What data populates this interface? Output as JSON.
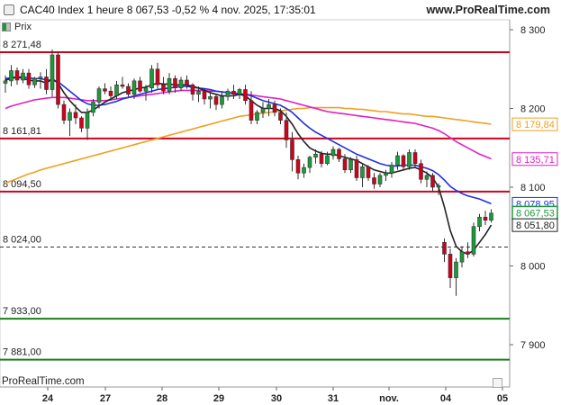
{
  "header": {
    "title": "CAC40 Index 1 heure 8 067,53 -0,52 % 4 nov. 2025, 17:35:01",
    "brand": "www.ProRealTime.com"
  },
  "legend": {
    "label": "Prix"
  },
  "footer": {
    "source": "ProRealTime.com"
  },
  "chart_data": {
    "type": "line",
    "subtype": "candlestick",
    "categories": [
      "24",
      "27",
      "28",
      "29",
      "30",
      "31",
      "nov.",
      "04",
      "05"
    ],
    "ylim": [
      7855,
      8315
    ],
    "y_ticks": [
      "8 300",
      "8 200",
      "8 100",
      "8 000",
      "7 900"
    ],
    "y_tick_values": [
      8300,
      8200,
      8100,
      8000,
      7900
    ],
    "levels": [
      {
        "label": "8 271,48",
        "value": 8271.48,
        "color": "#d0021b"
      },
      {
        "label": "8 161,81",
        "value": 8161.81,
        "color": "#d0021b"
      },
      {
        "label": "8 094,50",
        "value": 8094.5,
        "color": "#d0021b"
      },
      {
        "label": "8 024,00",
        "value": 8024.0,
        "color": "#333333",
        "dashed": true
      },
      {
        "label": "7 933,00",
        "value": 7933.0,
        "color": "#1a7f1a"
      },
      {
        "label": "7 881,00",
        "value": 7881.0,
        "color": "#1a7f1a"
      }
    ],
    "price_tags": [
      {
        "label": "8 179,84",
        "value": 8179.84,
        "color": "#f0a020"
      },
      {
        "label": "8 135,71",
        "value": 8135.71,
        "color": "#e020c0"
      },
      {
        "label": "8 078,95",
        "value": 8078.95,
        "color": "#2030e0"
      },
      {
        "label": "8 067,53",
        "value": 8067.53,
        "color": "#1a9a3a"
      },
      {
        "label": "8 051,80",
        "value": 8051.8,
        "color": "#222222"
      }
    ],
    "candles": [
      [
        8232,
        8242,
        8220,
        8235
      ],
      [
        8235,
        8255,
        8228,
        8248
      ],
      [
        8248,
        8252,
        8230,
        8236
      ],
      [
        8236,
        8250,
        8232,
        8245
      ],
      [
        8245,
        8250,
        8225,
        8230
      ],
      [
        8230,
        8240,
        8226,
        8238
      ],
      [
        8238,
        8246,
        8225,
        8240
      ],
      [
        8240,
        8250,
        8218,
        8224
      ],
      [
        8224,
        8275,
        8215,
        8268
      ],
      [
        8268,
        8272,
        8200,
        8205
      ],
      [
        8205,
        8210,
        8180,
        8185
      ],
      [
        8185,
        8200,
        8165,
        8195
      ],
      [
        8195,
        8205,
        8180,
        8188
      ],
      [
        8188,
        8190,
        8170,
        8175
      ],
      [
        8175,
        8200,
        8160,
        8195
      ],
      [
        8195,
        8212,
        8190,
        8208
      ],
      [
        8208,
        8228,
        8200,
        8225
      ],
      [
        8225,
        8232,
        8218,
        8222
      ],
      [
        8222,
        8228,
        8210,
        8216
      ],
      [
        8216,
        8235,
        8212,
        8230
      ],
      [
        8230,
        8240,
        8225,
        8228
      ],
      [
        8228,
        8232,
        8215,
        8218
      ],
      [
        8218,
        8238,
        8212,
        8235
      ],
      [
        8235,
        8240,
        8220,
        8222
      ],
      [
        8222,
        8230,
        8210,
        8226
      ],
      [
        8226,
        8255,
        8220,
        8250
      ],
      [
        8250,
        8258,
        8225,
        8230
      ],
      [
        8230,
        8240,
        8218,
        8222
      ],
      [
        8222,
        8245,
        8218,
        8238
      ],
      [
        8238,
        8242,
        8220,
        8226
      ],
      [
        8226,
        8240,
        8222,
        8236
      ],
      [
        8236,
        8242,
        8225,
        8230
      ],
      [
        8230,
        8232,
        8210,
        8218
      ],
      [
        8218,
        8228,
        8208,
        8222
      ],
      [
        8222,
        8226,
        8205,
        8212
      ],
      [
        8212,
        8222,
        8200,
        8215
      ],
      [
        8215,
        8218,
        8198,
        8205
      ],
      [
        8205,
        8220,
        8200,
        8215
      ],
      [
        8215,
        8225,
        8210,
        8222
      ],
      [
        8222,
        8230,
        8212,
        8218
      ],
      [
        8218,
        8226,
        8212,
        8224
      ],
      [
        8224,
        8230,
        8205,
        8210
      ],
      [
        8210,
        8222,
        8180,
        8185
      ],
      [
        8185,
        8198,
        8180,
        8195
      ],
      [
        8195,
        8208,
        8188,
        8200
      ],
      [
        8200,
        8212,
        8190,
        8205
      ],
      [
        8205,
        8210,
        8190,
        8195
      ],
      [
        8195,
        8200,
        8180,
        8185
      ],
      [
        8185,
        8195,
        8150,
        8160
      ],
      [
        8160,
        8170,
        8120,
        8135
      ],
      [
        8135,
        8140,
        8110,
        8118
      ],
      [
        8118,
        8130,
        8112,
        8125
      ],
      [
        8125,
        8140,
        8118,
        8138
      ],
      [
        8138,
        8148,
        8130,
        8142
      ],
      [
        8142,
        8146,
        8125,
        8130
      ],
      [
        8130,
        8145,
        8128,
        8140
      ],
      [
        8140,
        8152,
        8135,
        8148
      ],
      [
        8148,
        8150,
        8132,
        8136
      ],
      [
        8136,
        8142,
        8118,
        8122
      ],
      [
        8122,
        8138,
        8118,
        8135
      ],
      [
        8135,
        8140,
        8108,
        8112
      ],
      [
        8112,
        8130,
        8100,
        8126
      ],
      [
        8126,
        8128,
        8108,
        8112
      ],
      [
        8112,
        8118,
        8098,
        8104
      ],
      [
        8104,
        8118,
        8100,
        8115
      ],
      [
        8115,
        8122,
        8108,
        8118
      ],
      [
        8118,
        8132,
        8112,
        8128
      ],
      [
        8128,
        8145,
        8122,
        8140
      ],
      [
        8140,
        8142,
        8122,
        8126
      ],
      [
        8126,
        8148,
        8122,
        8144
      ],
      [
        8144,
        8148,
        8126,
        8130
      ],
      [
        8130,
        8135,
        8105,
        8110
      ],
      [
        8110,
        8120,
        8100,
        8115
      ],
      [
        8115,
        8118,
        8095,
        8100
      ],
      [
        8100,
        8105,
        8090,
        8102
      ],
      [
        8030,
        8035,
        8005,
        8015
      ],
      [
        8015,
        8022,
        7972,
        7985
      ],
      [
        7985,
        8010,
        7962,
        8005
      ],
      [
        8005,
        8025,
        7998,
        8018
      ],
      [
        8018,
        8030,
        8010,
        8015
      ],
      [
        8015,
        8055,
        8012,
        8050
      ],
      [
        8050,
        8066,
        8044,
        8062
      ],
      [
        8062,
        8070,
        8052,
        8058
      ],
      [
        8058,
        8072,
        8055,
        8067
      ]
    ],
    "series": [
      {
        "type": "sma",
        "color": "#222222",
        "values": [
          8236,
          8238,
          8240,
          8238,
          8236,
          8235,
          8235,
          8232,
          8238,
          8232,
          8220,
          8210,
          8202,
          8195,
          8195,
          8198,
          8203,
          8208,
          8212,
          8216,
          8220,
          8222,
          8224,
          8226,
          8227,
          8230,
          8232,
          8231,
          8231,
          8230,
          8230,
          8230,
          8228,
          8226,
          8223,
          8220,
          8218,
          8216,
          8216,
          8216,
          8218,
          8216,
          8210,
          8204,
          8200,
          8200,
          8200,
          8197,
          8190,
          8180,
          8168,
          8158,
          8150,
          8146,
          8143,
          8142,
          8142,
          8140,
          8138,
          8136,
          8134,
          8130,
          8126,
          8122,
          8120,
          8118,
          8118,
          8120,
          8122,
          8124,
          8125,
          8122,
          8118,
          8112,
          8100,
          8075,
          8045,
          8025,
          8018,
          8015,
          8020,
          8030,
          8040,
          8052
        ]
      },
      {
        "type": "sma",
        "color": "#2030e0",
        "values": [
          8238,
          8239,
          8240,
          8240,
          8239,
          8238,
          8238,
          8236,
          8236,
          8234,
          8228,
          8222,
          8216,
          8210,
          8206,
          8204,
          8204,
          8205,
          8207,
          8209,
          8212,
          8214,
          8216,
          8218,
          8220,
          8222,
          8224,
          8225,
          8226,
          8227,
          8228,
          8228,
          8227,
          8226,
          8225,
          8224,
          8222,
          8221,
          8220,
          8219,
          8218,
          8218,
          8216,
          8213,
          8210,
          8208,
          8206,
          8204,
          8200,
          8195,
          8188,
          8181,
          8175,
          8170,
          8166,
          8162,
          8158,
          8154,
          8150,
          8146,
          8142,
          8139,
          8136,
          8133,
          8130,
          8128,
          8127,
          8127,
          8128,
          8128,
          8128,
          8126,
          8124,
          8121,
          8116,
          8109,
          8101,
          8096,
          8092,
          8089,
          8087,
          8085,
          8082,
          8079
        ]
      },
      {
        "type": "sma",
        "color": "#e020c0",
        "values": [
          8200,
          8203,
          8205,
          8207,
          8209,
          8211,
          8212,
          8213,
          8214,
          8214,
          8214,
          8213,
          8212,
          8211,
          8210,
          8210,
          8210,
          8210,
          8211,
          8212,
          8213,
          8214,
          8215,
          8216,
          8217,
          8218,
          8219,
          8220,
          8221,
          8222,
          8223,
          8223,
          8223,
          8223,
          8223,
          8222,
          8222,
          8221,
          8220,
          8220,
          8219,
          8218,
          8217,
          8216,
          8215,
          8214,
          8213,
          8212,
          8210,
          8208,
          8206,
          8204,
          8202,
          8200,
          8198,
          8196,
          8195,
          8194,
          8193,
          8192,
          8191,
          8190,
          8189,
          8188,
          8187,
          8186,
          8185,
          8184,
          8183,
          8182,
          8181,
          8179,
          8177,
          8175,
          8172,
          8168,
          8163,
          8158,
          8154,
          8150,
          8146,
          8142,
          8139,
          8136
        ]
      },
      {
        "type": "sma",
        "color": "#f0a020",
        "values": [
          8105,
          8108,
          8111,
          8114,
          8117,
          8119,
          8122,
          8124,
          8126,
          8128,
          8130,
          8132,
          8134,
          8136,
          8138,
          8140,
          8142,
          8144,
          8146,
          8148,
          8150,
          8152,
          8154,
          8156,
          8158,
          8160,
          8162,
          8164,
          8166,
          8168,
          8170,
          8172,
          8174,
          8176,
          8178,
          8180,
          8182,
          8184,
          8186,
          8188,
          8190,
          8191,
          8192,
          8193,
          8194,
          8195,
          8196,
          8197,
          8198,
          8199,
          8200,
          8200,
          8201,
          8201,
          8201,
          8201,
          8201,
          8201,
          8200,
          8200,
          8199,
          8199,
          8198,
          8197,
          8196,
          8196,
          8195,
          8194,
          8193,
          8193,
          8192,
          8191,
          8190,
          8190,
          8189,
          8188,
          8187,
          8186,
          8185,
          8184,
          8183,
          8182,
          8181,
          8180
        ]
      }
    ]
  }
}
